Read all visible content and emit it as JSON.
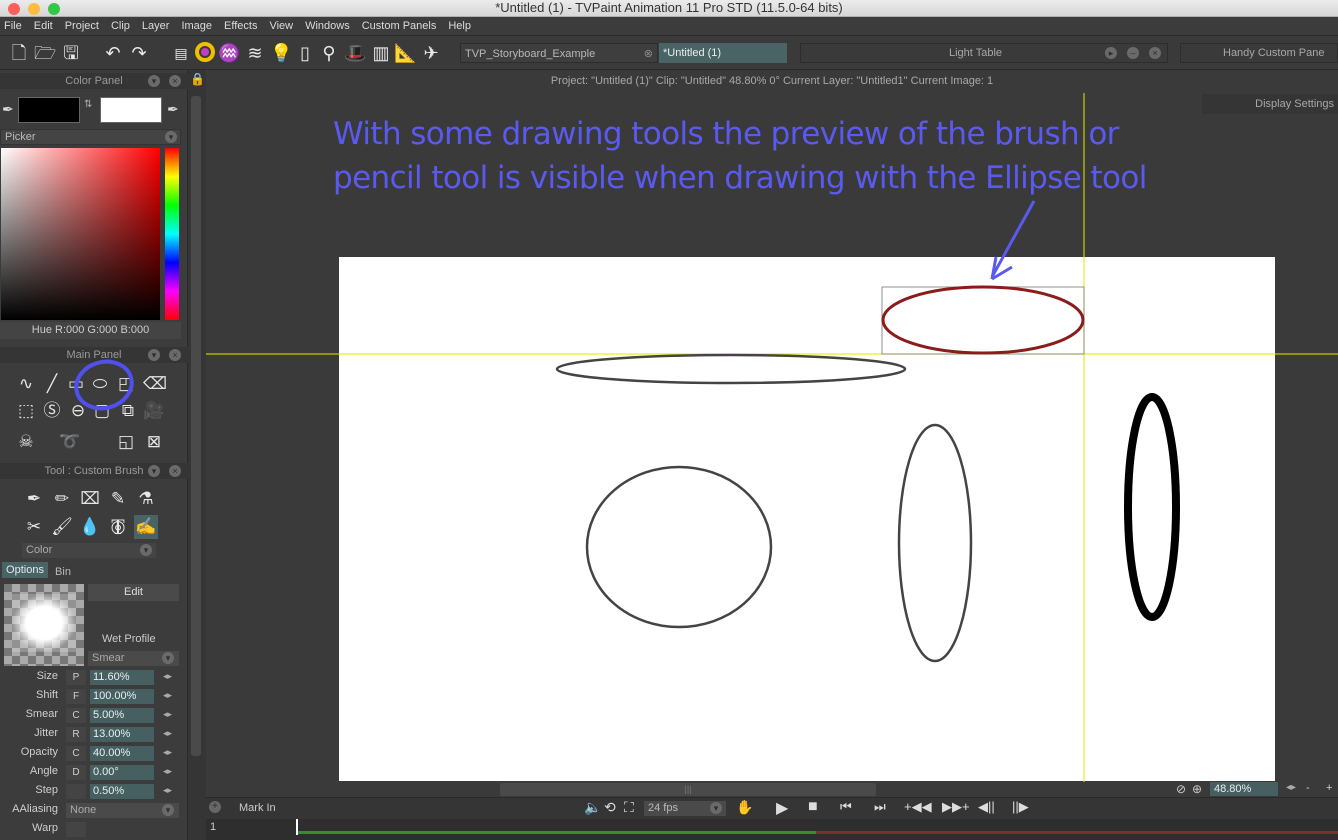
{
  "window": {
    "title": "*Untitled (1) - TVPaint Animation 11 Pro STD (11.5.0-64 bits)"
  },
  "menu": [
    "File",
    "Edit",
    "Project",
    "Clip",
    "Layer",
    "Image",
    "Effects",
    "View",
    "Windows",
    "Custom Panels",
    "Help"
  ],
  "toolbar": {
    "tabs": [
      {
        "label": "TVP_Storyboard_Example",
        "active": false
      },
      {
        "label": "*Untitled (1)",
        "active": true
      }
    ],
    "light_table_label": "Light Table",
    "custom_pane_label": "Handy Custom Pane"
  },
  "status": {
    "info": "Project:  \"Untitled (1)\"  Clip: \"Untitled\"   48.80%   0°  Current Layer: \"Untitled1\"  Current Image: 1"
  },
  "display_settings_label": "Display Settings",
  "color_panel": {
    "title": "Color Panel",
    "picker_mode": "Picker",
    "readout": "Hue R:000 G:000 B:000",
    "primary_color": "#000000",
    "secondary_color": "#ffffff"
  },
  "main_panel": {
    "title": "Main Panel"
  },
  "tool_panel": {
    "title": "Tool : Custom Brush",
    "mode": "Color",
    "tabs": [
      "Options",
      "Bin"
    ],
    "edit_label": "Edit",
    "wet_profile_label": "Wet Profile",
    "merge_mode": "Smear",
    "properties": [
      {
        "label": "Size",
        "key": "P",
        "value": "11.60%"
      },
      {
        "label": "Shift",
        "key": "F",
        "value": "100.00%"
      },
      {
        "label": "Smear",
        "key": "C",
        "value": "5.00%"
      },
      {
        "label": "Jitter",
        "key": "R",
        "value": "13.00%"
      },
      {
        "label": "Opacity",
        "key": "C",
        "value": "40.00%"
      },
      {
        "label": "Angle",
        "key": "D",
        "value": "0.00°"
      },
      {
        "label": "Step",
        "key": "",
        "value": "0.50%"
      }
    ],
    "aaliasing_label": "AAliasing",
    "aaliasing_value": "None",
    "warp_label": "Warp"
  },
  "annotation": {
    "line1": "With some drawing tools the preview of the brush or",
    "line2": "pencil tool is visible when drawing with the Ellipse tool",
    "color": "#5a5af0"
  },
  "playback": {
    "mark_in_label": "Mark In",
    "fps": "24 fps",
    "zoom": "48.80%",
    "frame": "1"
  }
}
